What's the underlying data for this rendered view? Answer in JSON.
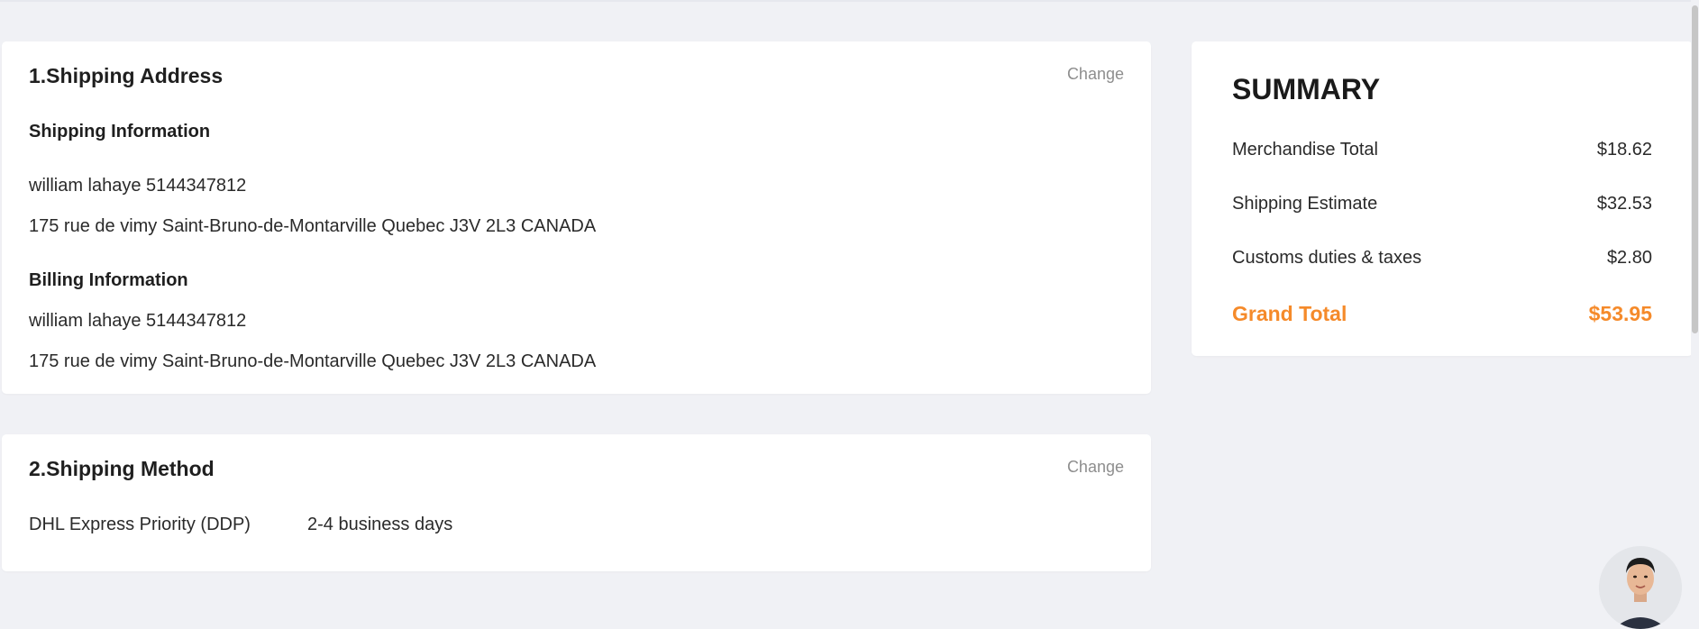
{
  "shipping_address": {
    "title": "1.Shipping Address",
    "change_label": "Change",
    "shipping_info_title": "Shipping Information",
    "shipping_name_phone": "william lahaye 5144347812",
    "shipping_address_line": "175 rue de vimy Saint-Bruno-de-Montarville Quebec J3V 2L3 CANADA",
    "billing_info_title": "Billing Information",
    "billing_name_phone": "william lahaye 5144347812",
    "billing_address_line": "175 rue de vimy Saint-Bruno-de-Montarville Quebec J3V 2L3 CANADA"
  },
  "shipping_method": {
    "title": "2.Shipping Method",
    "change_label": "Change",
    "carrier": "DHL Express Priority (DDP)",
    "delivery_time": "2-4 business days"
  },
  "summary": {
    "title": "SUMMARY",
    "rows": [
      {
        "label": "Merchandise Total",
        "value": "$18.62"
      },
      {
        "label": "Shipping Estimate",
        "value": "$32.53"
      },
      {
        "label": "Customs duties & taxes",
        "value": "$2.80"
      }
    ],
    "grand_total_label": "Grand Total",
    "grand_total_value": "$53.95"
  },
  "colors": {
    "background": "#f0f1f5",
    "card": "#ffffff",
    "accent": "#f58a2a",
    "muted": "#8e8e8e"
  },
  "icons": {
    "support_avatar": "support-agent-avatar"
  }
}
